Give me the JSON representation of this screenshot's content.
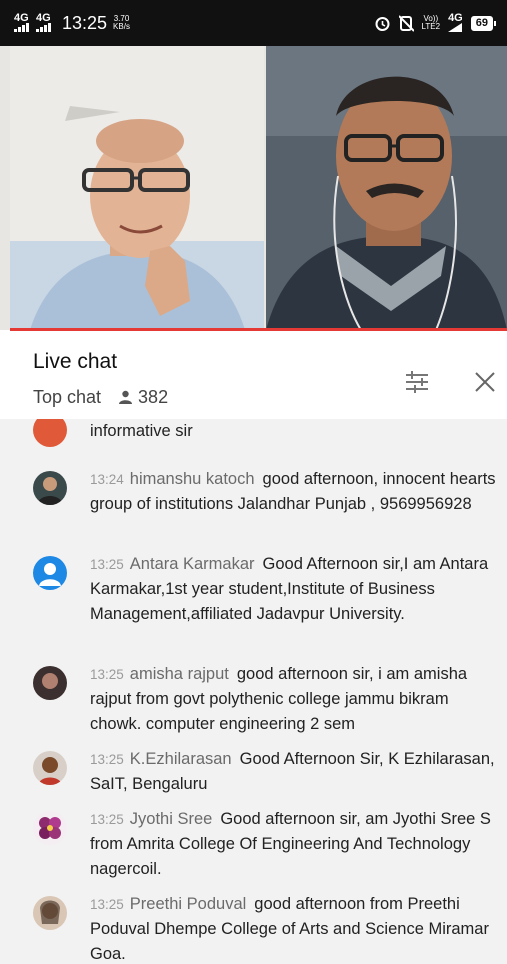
{
  "status_bar": {
    "signal_label": "4G",
    "time": "13:25",
    "speed_value": "3.70",
    "speed_unit": "KB/s",
    "lte_top": "Vo))",
    "lte_bottom": "LTE2",
    "network": "4G",
    "battery": "69"
  },
  "chat": {
    "title": "Live chat",
    "mode": "Top chat",
    "viewer_count": "382",
    "filter_icon": "tune-icon",
    "close_icon": "close-icon",
    "partial_message": "informative sir",
    "messages": [
      {
        "time": "13:24",
        "author": "himanshu katoch",
        "text": "good afternoon, innocent hearts group of institutions Jalandhar Punjab , 9569956928",
        "avatar_color": "#2f4f4f"
      },
      {
        "time": "13:25",
        "author": "Antara Karmakar",
        "text": "Good Afternoon sir,I am Antara Karmakar,1st year student,Institute of Business Management,affiliated Jadavpur University.",
        "avatar_color": "#1e88e5"
      },
      {
        "time": "13:25",
        "author": "amisha rajput",
        "text": "good afternoon sir, i am amisha rajput from govt polythenic college jammu bikram chowk. computer engineering 2 sem",
        "avatar_color": "#3b2f2f"
      },
      {
        "time": "13:25",
        "author": "K.Ezhilarasan",
        "text": "Good Afternoon Sir, K Ezhilarasan, SaIT, Bengaluru",
        "avatar_color": "#7a4a2a"
      },
      {
        "time": "13:25",
        "author": "Jyothi Sree",
        "text": "Good afternoon sir, am Jyothi Sree S from Amrita College Of Engineering And Technology nagercoil.",
        "avatar_color": "#8e2a6e"
      },
      {
        "time": "13:25",
        "author": "Preethi Poduval",
        "text": "good afternoon from Preethi Poduval Dhempe College of Arts and Science Miramar Goa.",
        "avatar_color": "#a0785a"
      }
    ]
  }
}
